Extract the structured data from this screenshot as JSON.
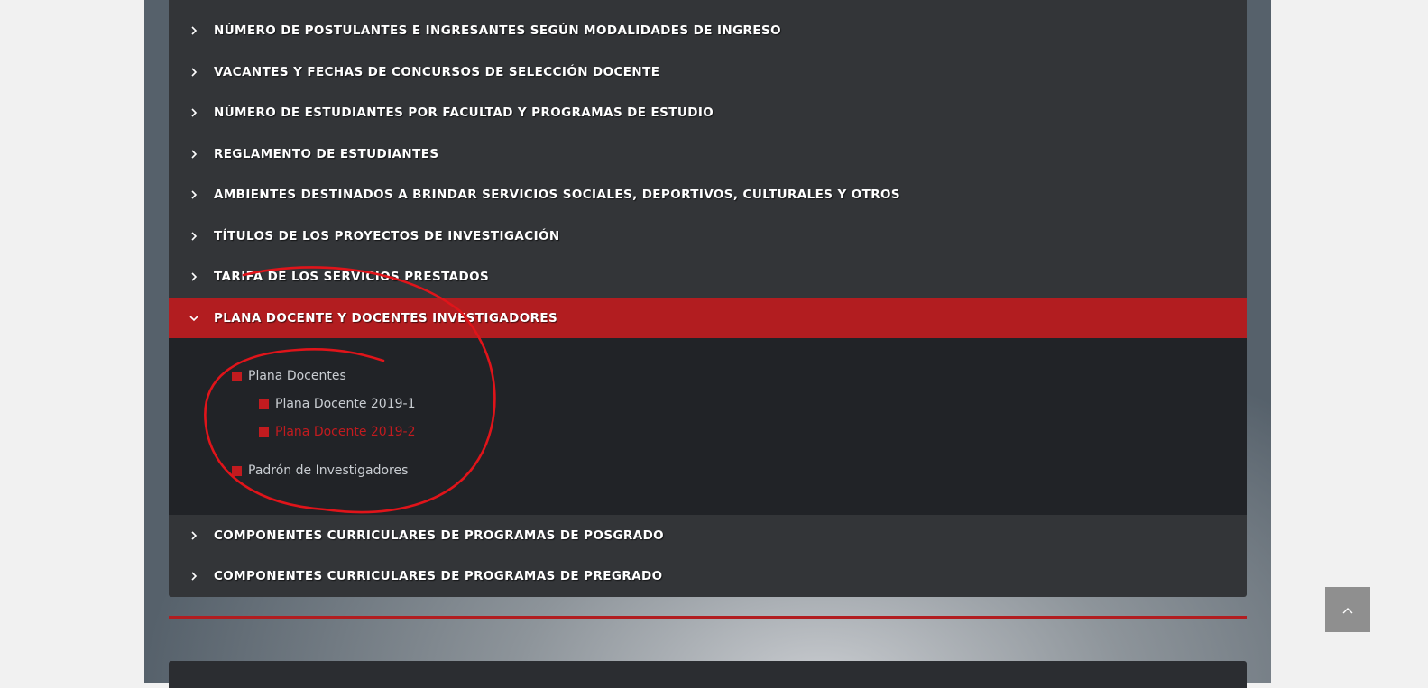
{
  "accordion": {
    "items": [
      {
        "label": "NÚMERO DE POSTULANTES E INGRESANTES SEGÚN MODALIDADES DE INGRESO"
      },
      {
        "label": "VACANTES Y FECHAS DE CONCURSOS DE SELECCIÓN DOCENTE"
      },
      {
        "label": "NÚMERO DE ESTUDIANTES POR FACULTAD Y PROGRAMAS DE ESTUDIO"
      },
      {
        "label": "REGLAMENTO DE ESTUDIANTES"
      },
      {
        "label": "AMBIENTES DESTINADOS A BRINDAR SERVICIOS SOCIALES, DEPORTIVOS, CULTURALES Y OTROS"
      },
      {
        "label": "TÍTULOS DE LOS PROYECTOS DE INVESTIGACIÓN"
      },
      {
        "label": "TARIFA DE LOS SERVICIOS PRESTADOS"
      },
      {
        "label": "PLANA DOCENTE Y DOCENTES INVESTIGADORES",
        "expanded": true
      },
      {
        "label": "COMPONENTES CURRICULARES DE PROGRAMAS DE POSGRADO"
      },
      {
        "label": "COMPONENTES CURRICULARES DE PROGRAMAS DE PREGRADO"
      }
    ],
    "expanded_panel": {
      "links": [
        {
          "label": "Plana Docentes"
        },
        {
          "label": "Plana Docente 2019-1"
        },
        {
          "label": "Plana Docente 2019-2",
          "selected": true
        },
        {
          "label": "Padrón de Investigadores"
        }
      ]
    }
  },
  "icons": {
    "collapsed": "chevron-right-icon",
    "expanded": "chevron-down-icon",
    "scroll_top": "chevron-up-icon"
  },
  "colors": {
    "accent": "#b21d20",
    "accordion_bg": "#333538",
    "panel_bg": "#212327",
    "link_text": "#c9cdd2",
    "selected_link": "#c21b1f",
    "annotation": "#e0141a"
  }
}
